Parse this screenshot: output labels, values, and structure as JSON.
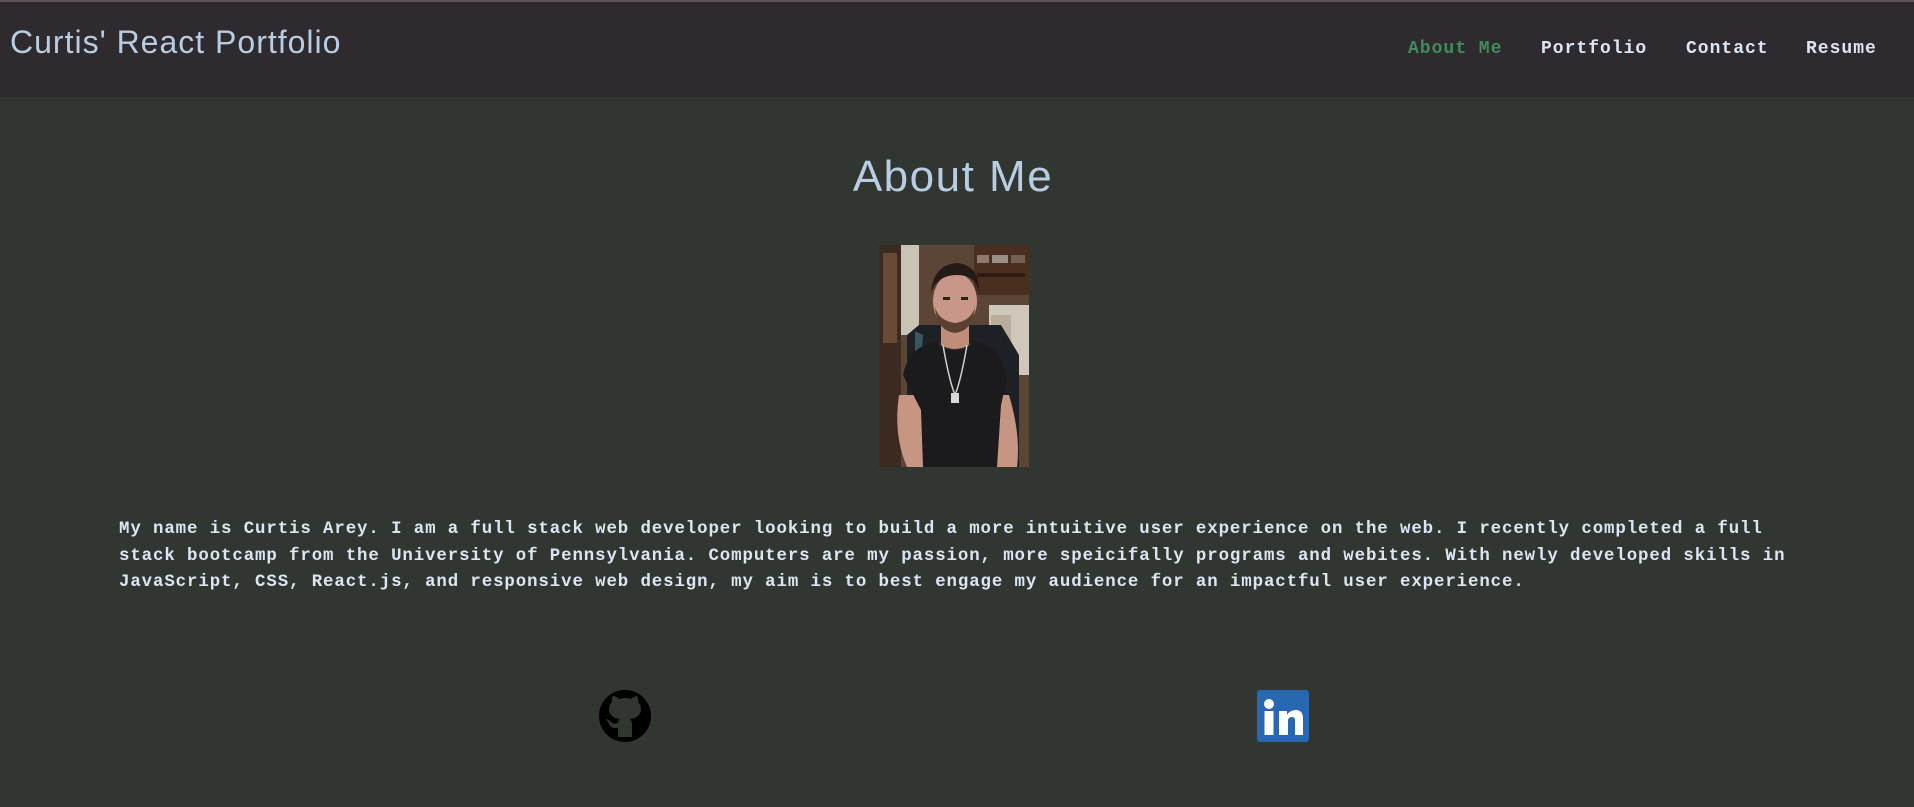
{
  "header": {
    "brand": "Curtis' React Portfolio",
    "nav": [
      {
        "label": "About Me",
        "active": true
      },
      {
        "label": "Portfolio",
        "active": false
      },
      {
        "label": "Contact",
        "active": false
      },
      {
        "label": "Resume",
        "active": false
      }
    ]
  },
  "about": {
    "title": "About Me",
    "photo": "profile-photo",
    "bio": "My name is Curtis Arey. I am a full stack web developer looking to build a more intuitive user experience on the web. I recently completed a full stack bootcamp from the University of Pennsylvania. Computers are my passion, more speicifally programs and webites. With newly developed skills in JavaScript, CSS, React.js, and responsive web design, my aim is to best engage my audience for an impactful user experience."
  },
  "social": {
    "github_icon": "github-icon",
    "linkedin_icon": "linkedin-icon"
  },
  "colors": {
    "header_bg": "#2f2a2e",
    "page_bg": "#323630",
    "brand": "#b7cde4",
    "active_link": "#3f8d5d",
    "nav_text": "#dbe6f4",
    "linkedin_blue": "#2867b2"
  }
}
